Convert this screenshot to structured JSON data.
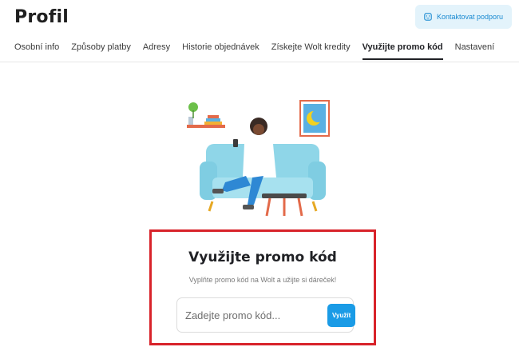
{
  "header": {
    "title": "Profil",
    "support_button_label": "Kontaktovat podporu",
    "support_icon": "chat-support-icon"
  },
  "tabs": [
    {
      "label": "Osobní info",
      "active": false
    },
    {
      "label": "Způsoby platby",
      "active": false
    },
    {
      "label": "Adresy",
      "active": false
    },
    {
      "label": "Historie objednávek",
      "active": false
    },
    {
      "label": "Získejte Wolt kredity",
      "active": false
    },
    {
      "label": "Využijte promo kód",
      "active": true
    },
    {
      "label": "Nastavení",
      "active": false
    }
  ],
  "promo": {
    "title": "Využijte promo kód",
    "subtitle": "Vyplňte promo kód na Wolt a užijte si dáreček!",
    "input_placeholder": "Zadejte promo kód...",
    "input_value": "",
    "button_label": "Využít"
  },
  "colors": {
    "accent": "#1a9be6",
    "support_bg": "#e3f3fb",
    "highlight_border": "#d8232a"
  }
}
